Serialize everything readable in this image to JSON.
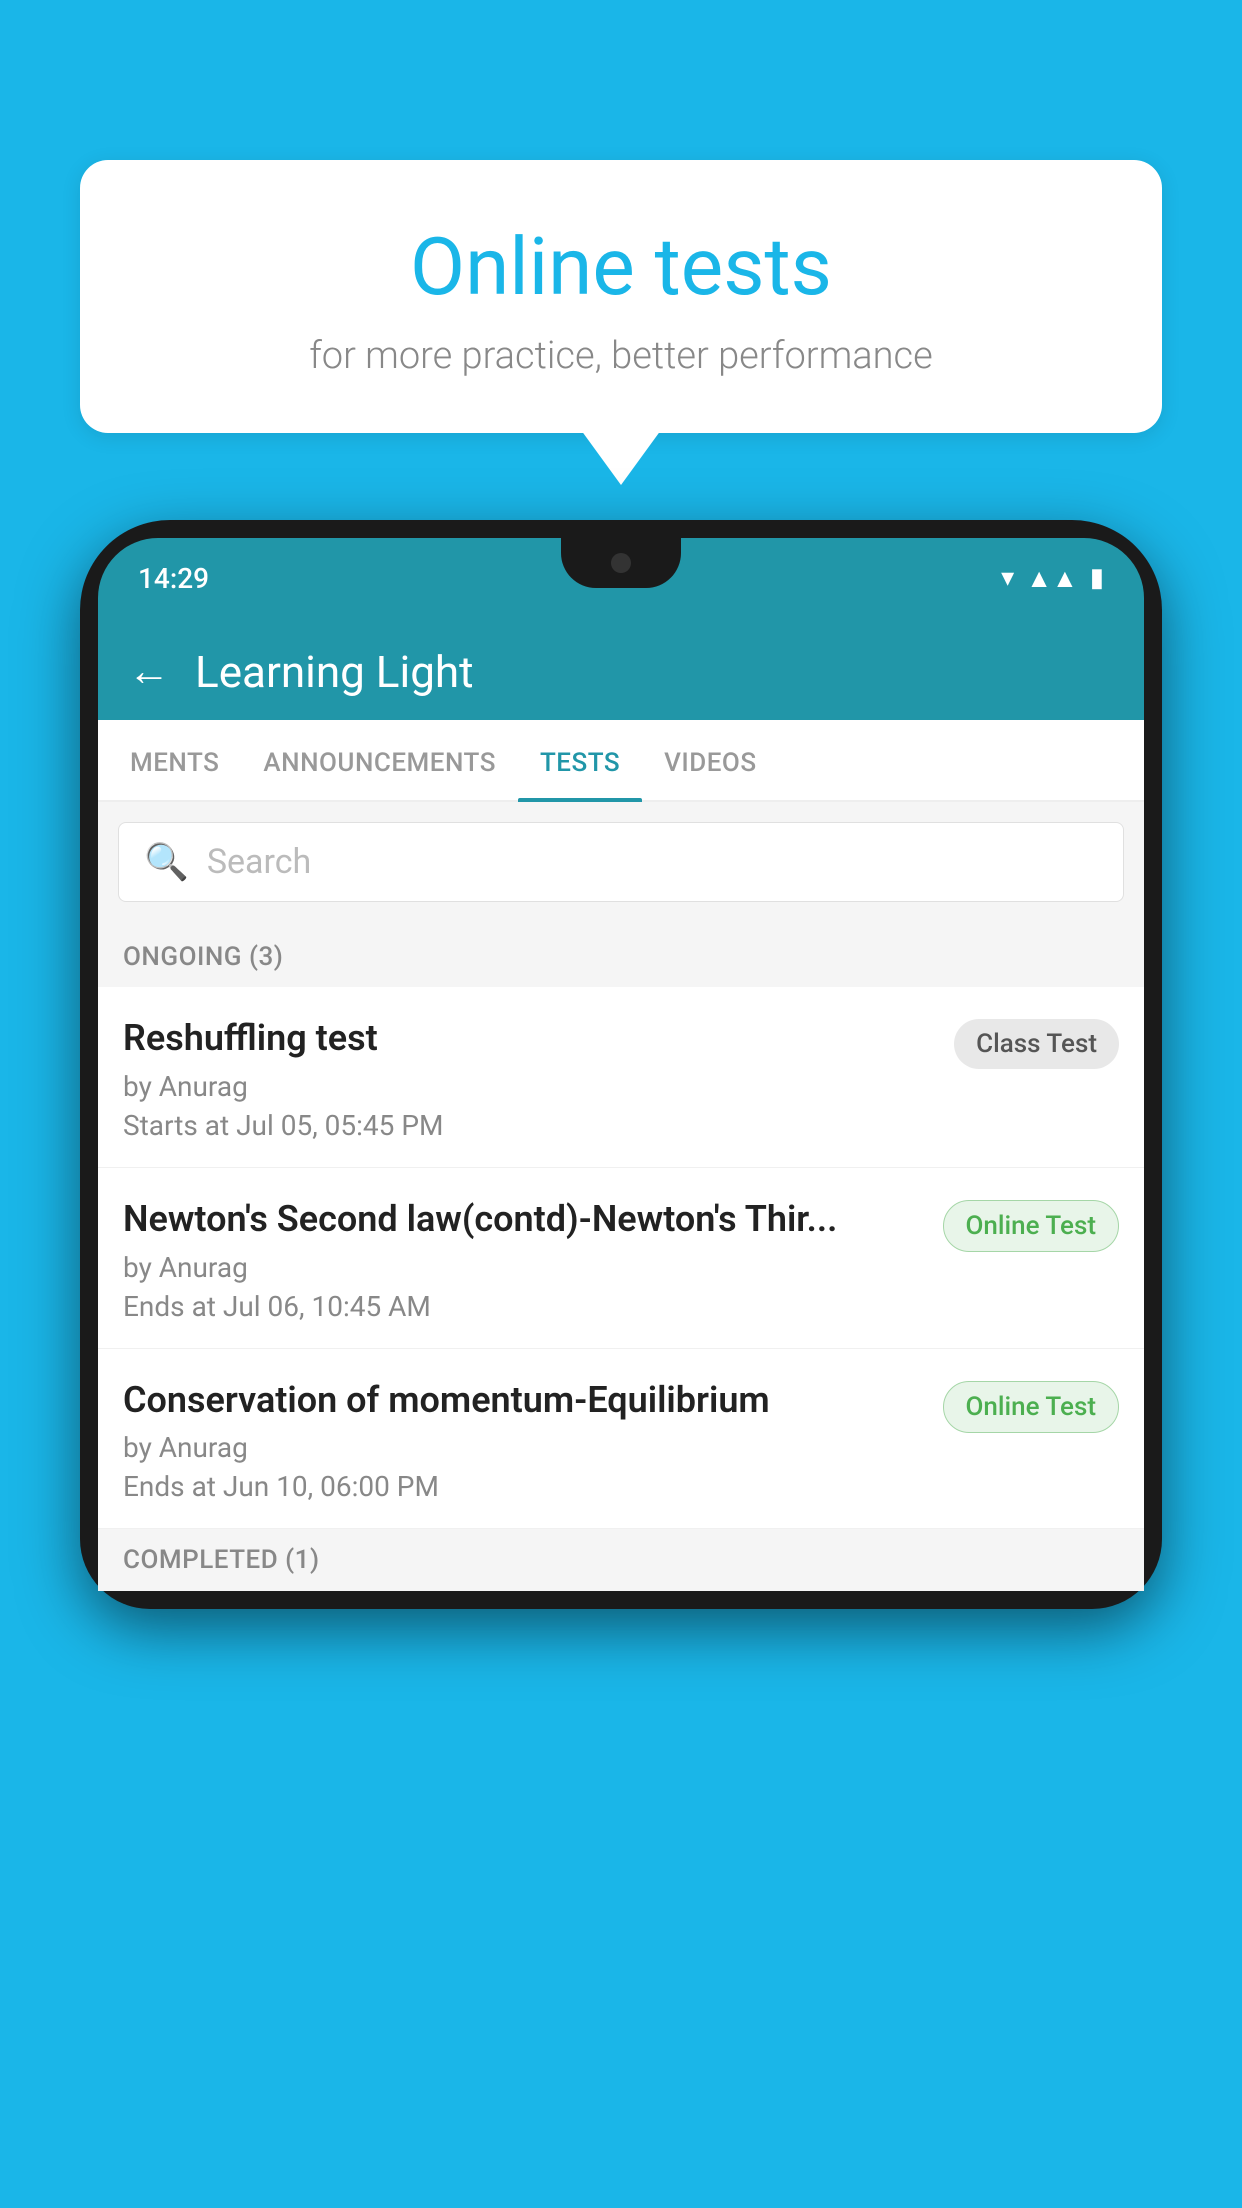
{
  "background": {
    "color": "#1ab6e8"
  },
  "bubble": {
    "title": "Online tests",
    "subtitle": "for more practice, better performance"
  },
  "phone": {
    "status_bar": {
      "time": "14:29"
    },
    "header": {
      "title": "Learning Light",
      "back_label": "←"
    },
    "tabs": [
      {
        "label": "MENTS",
        "active": false
      },
      {
        "label": "ANNOUNCEMENTS",
        "active": false
      },
      {
        "label": "TESTS",
        "active": true
      },
      {
        "label": "VIDEOS",
        "active": false
      }
    ],
    "search": {
      "placeholder": "Search"
    },
    "ongoing_section": {
      "label": "ONGOING (3)"
    },
    "tests": [
      {
        "title": "Reshuffling test",
        "author": "by Anurag",
        "date": "Starts at  Jul 05, 05:45 PM",
        "badge": "Class Test",
        "badge_type": "class"
      },
      {
        "title": "Newton's Second law(contd)-Newton's Thir...",
        "author": "by Anurag",
        "date": "Ends at  Jul 06, 10:45 AM",
        "badge": "Online Test",
        "badge_type": "online"
      },
      {
        "title": "Conservation of momentum-Equilibrium",
        "author": "by Anurag",
        "date": "Ends at  Jun 10, 06:00 PM",
        "badge": "Online Test",
        "badge_type": "online"
      }
    ],
    "completed_section": {
      "label": "COMPLETED (1)"
    }
  }
}
